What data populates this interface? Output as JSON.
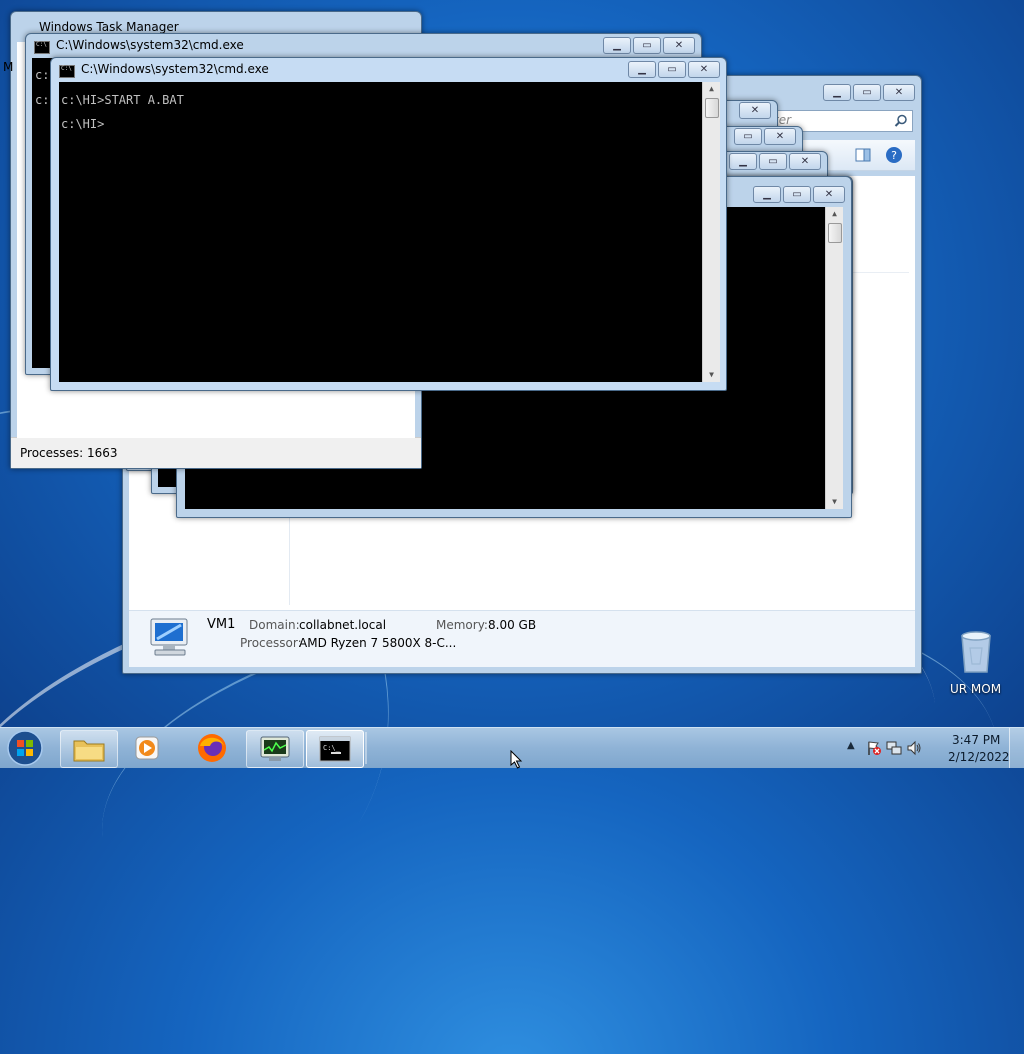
{
  "desktop": {
    "recycle_bin_label": "UR MOM"
  },
  "task_manager": {
    "title": "Windows Task Manager",
    "processes_label": "Processes: 1663",
    "menu_partial": "M"
  },
  "cmd_back": {
    "title": "C:\\Windows\\system32\\cmd.exe",
    "line1": "c:",
    "line2": "c:"
  },
  "cmd_front": {
    "title": "C:\\Windows\\system32\\cmd.exe",
    "line1": "c:\\HI>START A.BAT",
    "line2": "c:\\HI>"
  },
  "explorer": {
    "search_partial": "ter",
    "details": {
      "computer_name": "VM1",
      "domain_label": "Domain:",
      "domain_value": "collabnet.local",
      "memory_label": "Memory:",
      "memory_value": "8.00 GB",
      "processor_label": "Processor:",
      "processor_value": "AMD Ryzen 7 5800X 8-C..."
    }
  },
  "taskbar": {
    "time": "3:47 PM",
    "date": "2/12/2022",
    "pinned": [
      "start-orb",
      "file-explorer",
      "media-player",
      "firefox",
      "task-manager",
      "command-prompt"
    ]
  },
  "window_controls": {
    "minimize": "▁",
    "maximize": "▭",
    "close": "✕"
  },
  "colors": {
    "desktop_blue": "#1565c0",
    "window_frame": "#bcd3ea",
    "console_bg": "#000000",
    "console_text": "#c0c0c0"
  }
}
